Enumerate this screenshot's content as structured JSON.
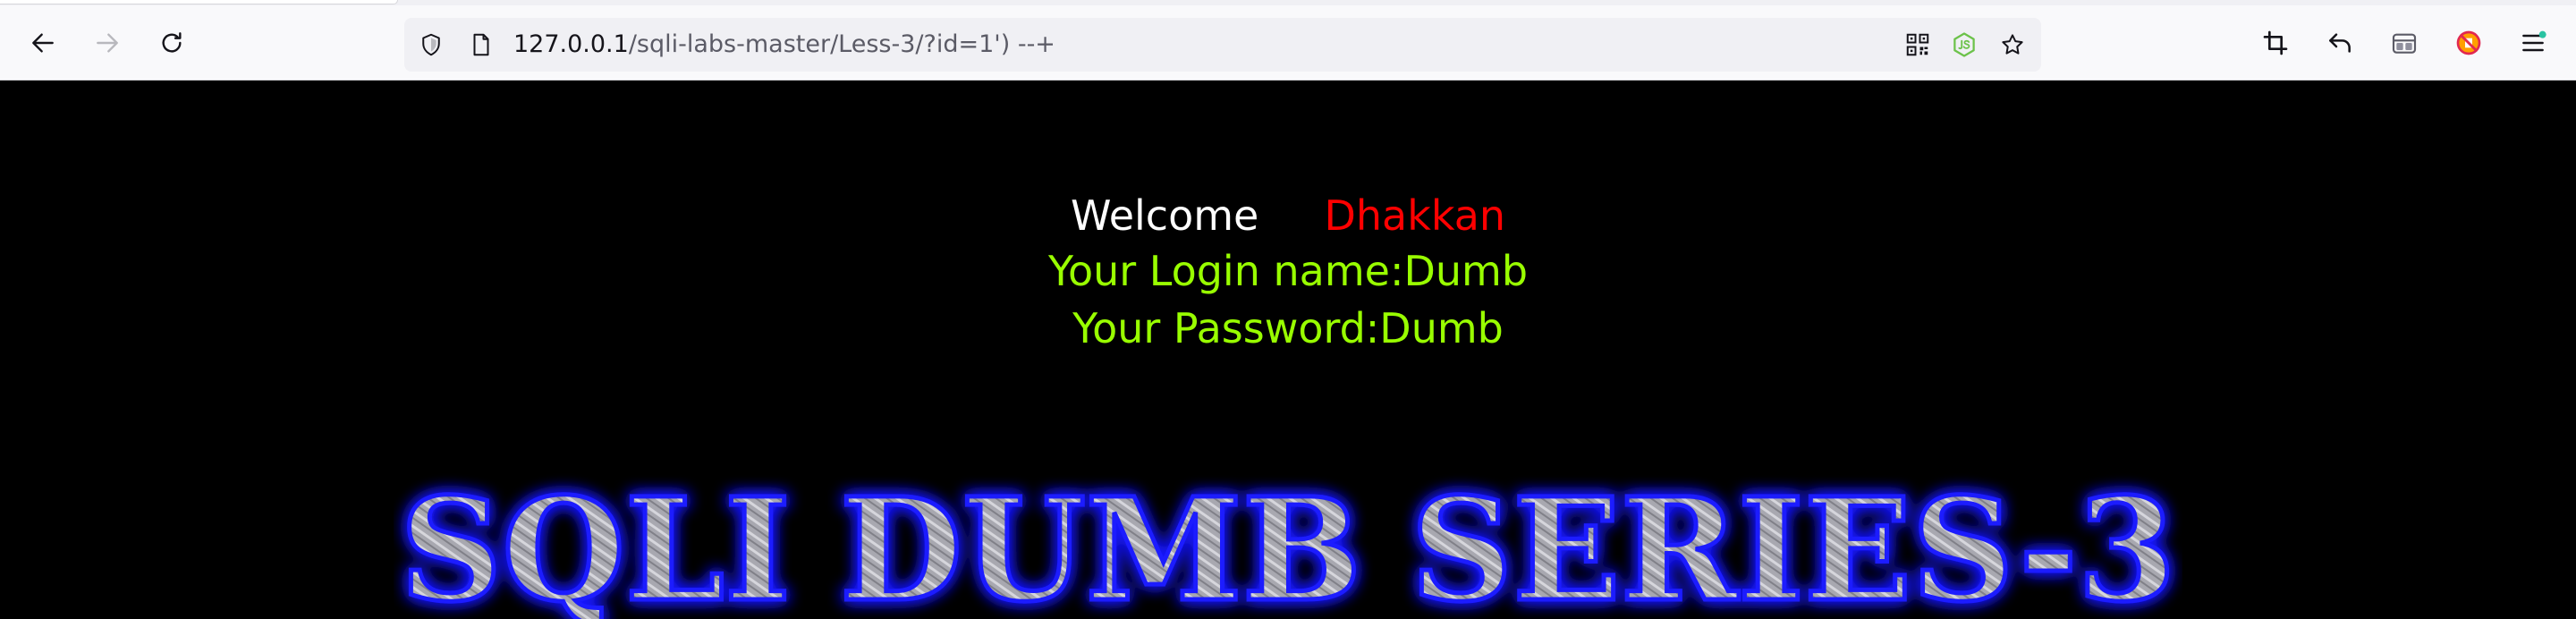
{
  "browser": {
    "url_host": "127.0.0.1",
    "url_path": "/sqli-labs-master/Less-3/?id=1') --+",
    "nav_icons": [
      "back-arrow-icon",
      "forward-arrow-icon",
      "reload-icon"
    ],
    "url_icons": [
      "shield-icon",
      "page-icon"
    ],
    "url_action_icons": [
      "qr-code-icon",
      "nodejs-icon",
      "star-icon"
    ],
    "toolbar_icons": [
      "crop-icon",
      "undo-icon",
      "container-icon",
      "blocked-extension-icon",
      "menu-icon"
    ]
  },
  "page": {
    "welcome_label": "Welcome",
    "welcome_name": "Dhakkan",
    "login_name_line": "Your Login name:Dumb",
    "password_line": "Your Password:Dumb",
    "banner_text": "SQLI DUMB SERIES-3",
    "colors": {
      "background": "#000000",
      "welcome": "#ffffff",
      "name": "#ff0000",
      "result": "#99ff00",
      "banner_glow": "#1a1aff"
    }
  }
}
